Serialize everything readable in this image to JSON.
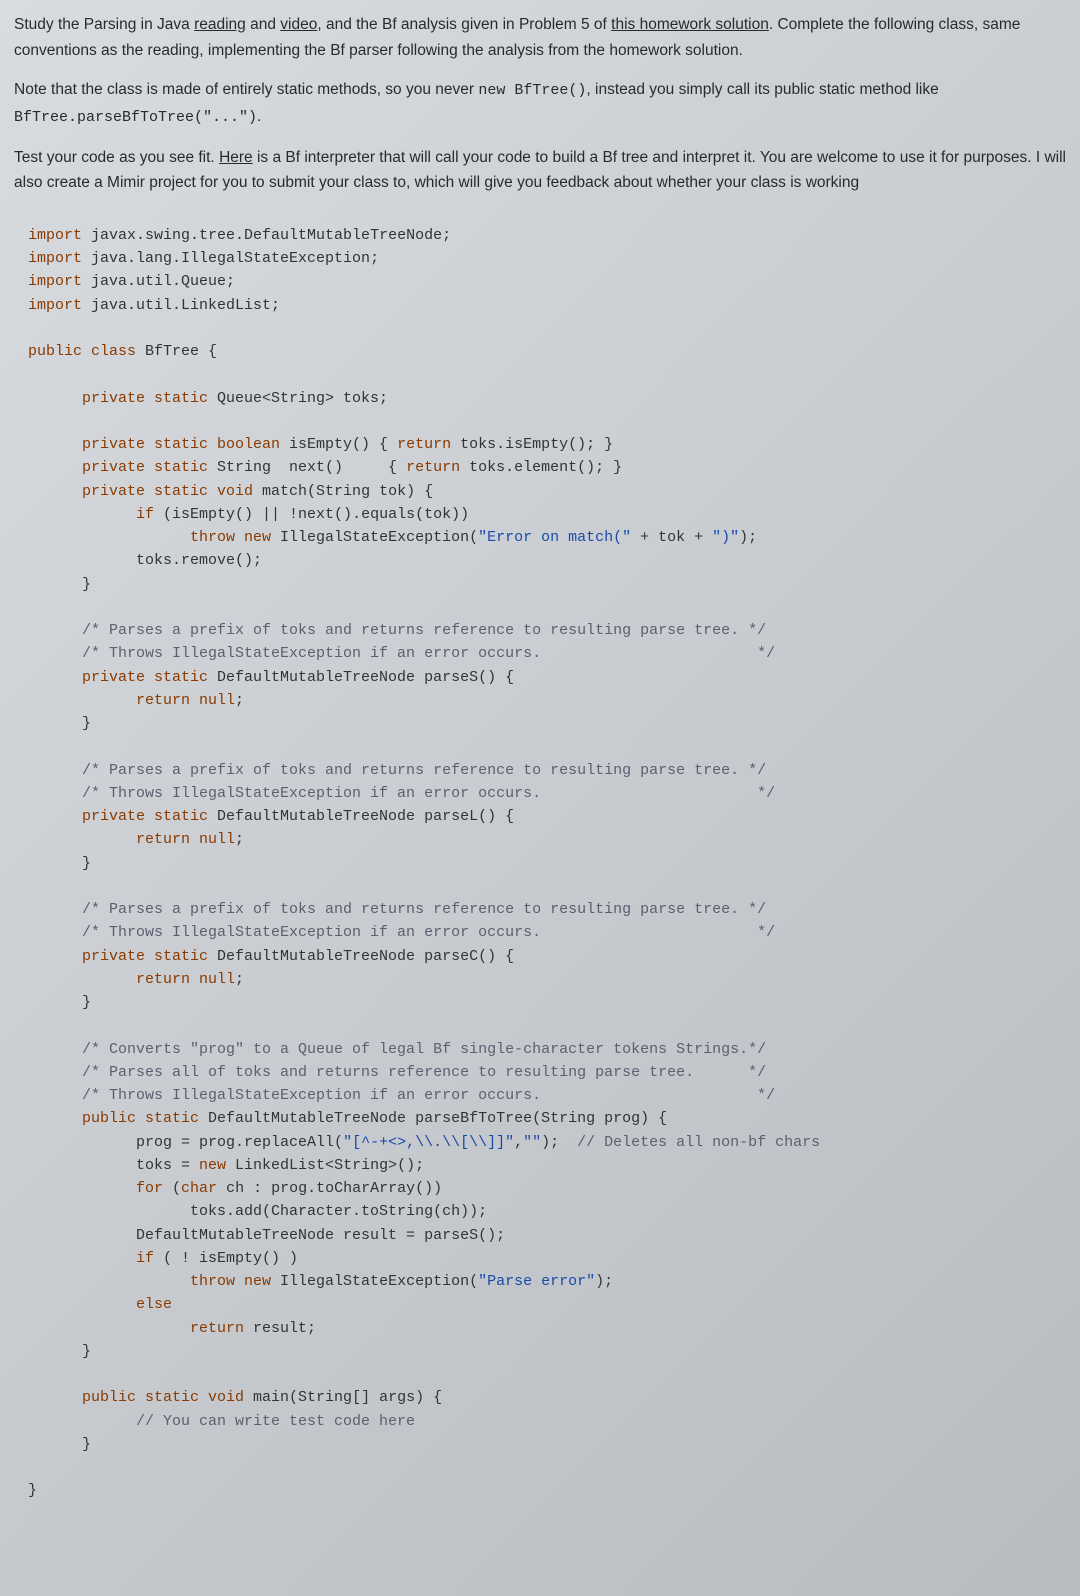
{
  "instructions": {
    "p1_a": "Study the Parsing in Java ",
    "link_reading": "reading",
    "p1_b": " and ",
    "link_video": "video",
    "p1_c": ", and the Bf analysis given in Problem 5 of ",
    "link_homework": "this homework solution",
    "p1_d": ". Complete the following class, same conventions as the reading, implementing the Bf parser following the analysis from the homework solution.",
    "p2_a": "Note that the class is made of entirely static methods, so you never ",
    "p2_code1": "new BfTree()",
    "p2_b": ", instead you simply call its public static method like ",
    "p2_code2": "BfTree.parseBfToTree(\"...\")",
    "p2_c": ".",
    "p3_a": "Test your code as you see fit. ",
    "link_here": "Here",
    "p3_b": " is a Bf interpreter that will call your code to build a Bf tree and interpret it. You are welcome to use it for purposes. I will also create a Mimir project for you to submit your class to, which will give you feedback about whether your class is working"
  },
  "code": {
    "l1a": "import",
    "l1b": " javax.swing.tree.DefaultMutableTreeNode;",
    "l2a": "import",
    "l2b": " java.lang.IllegalStateException;",
    "l3a": "import",
    "l3b": " java.util.Queue;",
    "l4a": "import",
    "l4b": " java.util.LinkedList;",
    "l6a": "public class ",
    "l6b": "BfTree",
    "l6c": " {",
    "l8a": "      private static ",
    "l8b": "Queue<String> toks;",
    "l10a": "      private static boolean ",
    "l10b": "isEmpty() { ",
    "l10c": "return",
    "l10d": " toks.isEmpty(); }",
    "l11a": "      private static ",
    "l11b": "String  next()     { ",
    "l11c": "return",
    "l11d": " toks.element(); }",
    "l12a": "      private static void ",
    "l12b": "match(String tok) {",
    "l13a": "            if",
    "l13b": " (isEmpty() || !next().equals(tok))",
    "l14a": "                  throw new ",
    "l14b": "IllegalStateException(",
    "l14c": "\"Error on match(\"",
    "l14d": " + tok + ",
    "l14e": "\")\"",
    "l14f": ");",
    "l15": "            toks.remove();",
    "l16": "      }",
    "l18": "      /* Parses a prefix of toks and returns reference to resulting parse tree. */",
    "l19": "      /* Throws IllegalStateException if an error occurs.                        */",
    "l20a": "      private static ",
    "l20b": "DefaultMutableTreeNode parseS() {",
    "l21a": "            return ",
    "l21b": "null",
    "l21c": ";",
    "l22": "      }",
    "l24": "      /* Parses a prefix of toks and returns reference to resulting parse tree. */",
    "l25": "      /* Throws IllegalStateException if an error occurs.                        */",
    "l26a": "      private static ",
    "l26b": "DefaultMutableTreeNode parseL() {",
    "l27a": "            return ",
    "l27b": "null",
    "l27c": ";",
    "l28": "      }",
    "l30": "      /* Parses a prefix of toks and returns reference to resulting parse tree. */",
    "l31": "      /* Throws IllegalStateException if an error occurs.                        */",
    "l32a": "      private static ",
    "l32b": "DefaultMutableTreeNode parseC() {",
    "l33a": "            return ",
    "l33b": "null",
    "l33c": ";",
    "l34": "      }",
    "l36": "      /* Converts \"prog\" to a Queue of legal Bf single-character tokens Strings.*/",
    "l37": "      /* Parses all of toks and returns reference to resulting parse tree.      */",
    "l38": "      /* Throws IllegalStateException if an error occurs.                        */",
    "l39a": "      public static ",
    "l39b": "DefaultMutableTreeNode parseBfToTree(String prog) {",
    "l40a": "            prog = prog.replaceAll(",
    "l40b": "\"[^-+<>,\\\\.\\\\[\\\\]]\"",
    "l40c": ",",
    "l40d": "\"\"",
    "l40e": ");  ",
    "l40f": "// Deletes all non-bf chars",
    "l41a": "            toks = ",
    "l41b": "new ",
    "l41c": "LinkedList<String>();",
    "l42a": "            for ",
    "l42b": "(",
    "l42c": "char ",
    "l42d": "ch : prog.toCharArray())",
    "l43": "                  toks.add(Character.toString(ch));",
    "l44": "            DefaultMutableTreeNode result = parseS();",
    "l45a": "            if ",
    "l45b": "( ! isEmpty() )",
    "l46a": "                  throw new ",
    "l46b": "IllegalStateException(",
    "l46c": "\"Parse error\"",
    "l46d": ");",
    "l47": "            else",
    "l48a": "                  return ",
    "l48b": "result;",
    "l49": "      }",
    "l51a": "      public static void ",
    "l51b": "main(String[] args) {",
    "l52": "            // You can write test code here",
    "l53": "      }",
    "l55": "}"
  }
}
